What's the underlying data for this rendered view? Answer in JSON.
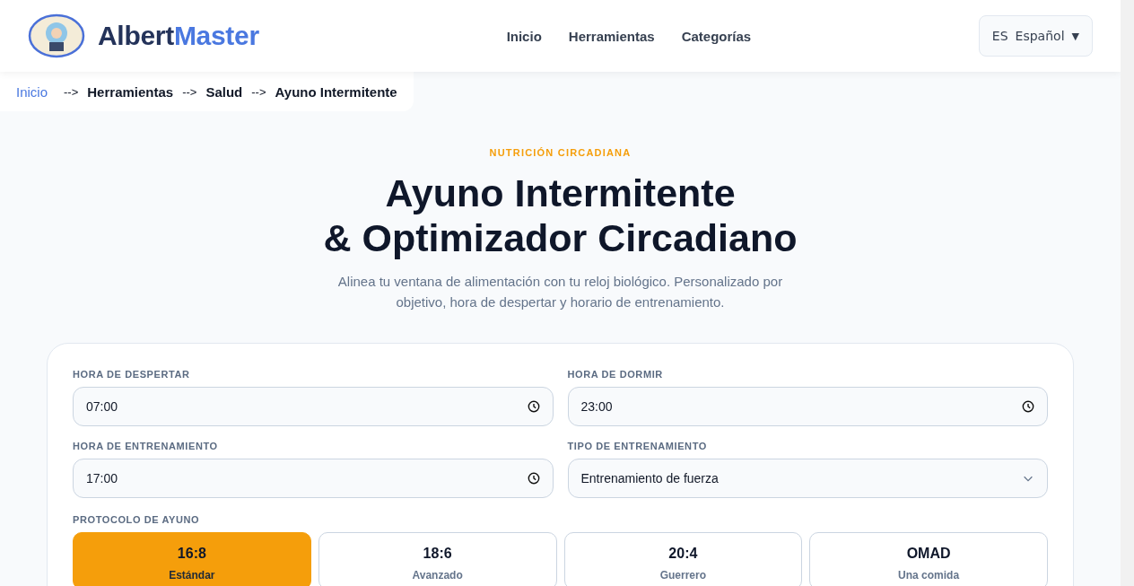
{
  "header": {
    "brand": {
      "first": "Albert",
      "second": "Master"
    },
    "nav": [
      {
        "label": "Inicio"
      },
      {
        "label": "Herramientas"
      },
      {
        "label": "Categorías"
      }
    ],
    "language": {
      "code": "ES",
      "label": "Español",
      "caret": "▼"
    }
  },
  "breadcrumb": {
    "items": [
      {
        "label": "Inicio",
        "kind": "link"
      },
      {
        "label": "Herramientas",
        "kind": "text"
      },
      {
        "label": "Salud",
        "kind": "text"
      },
      {
        "label": "Ayuno Intermitente",
        "kind": "text"
      }
    ],
    "separator": "-->"
  },
  "hero": {
    "eyebrow": "NUTRICIÓN CIRCADIANA",
    "title_lines": [
      "Ayuno Intermitente",
      "& Optimizador Circadiano"
    ],
    "subtitle": "Alinea tu ventana de alimentación con tu reloj biológico. Personalizado por objetivo, hora de despertar y horario de entrenamiento."
  },
  "form": {
    "fields": [
      {
        "label": "HORA DE DESPERTAR",
        "value": "07:00",
        "kind": "time"
      },
      {
        "label": "HORA DE DORMIR",
        "value": "23:00",
        "kind": "time"
      },
      {
        "label": "HORA DE ENTRENAMIENTO",
        "value": "17:00",
        "kind": "time"
      },
      {
        "label": "TIPO DE ENTRENAMIENTO",
        "value": "Entrenamiento de fuerza",
        "kind": "select"
      }
    ],
    "protocol": {
      "label": "PROTOCOLO DE AYUNO",
      "options": [
        {
          "ratio": "16:8",
          "name": "Estándar",
          "selected": true
        },
        {
          "ratio": "18:6",
          "name": "Avanzado",
          "selected": false
        },
        {
          "ratio": "20:4",
          "name": "Guerrero",
          "selected": false
        },
        {
          "ratio": "OMAD",
          "name": "Una comida",
          "selected": false
        }
      ]
    }
  }
}
